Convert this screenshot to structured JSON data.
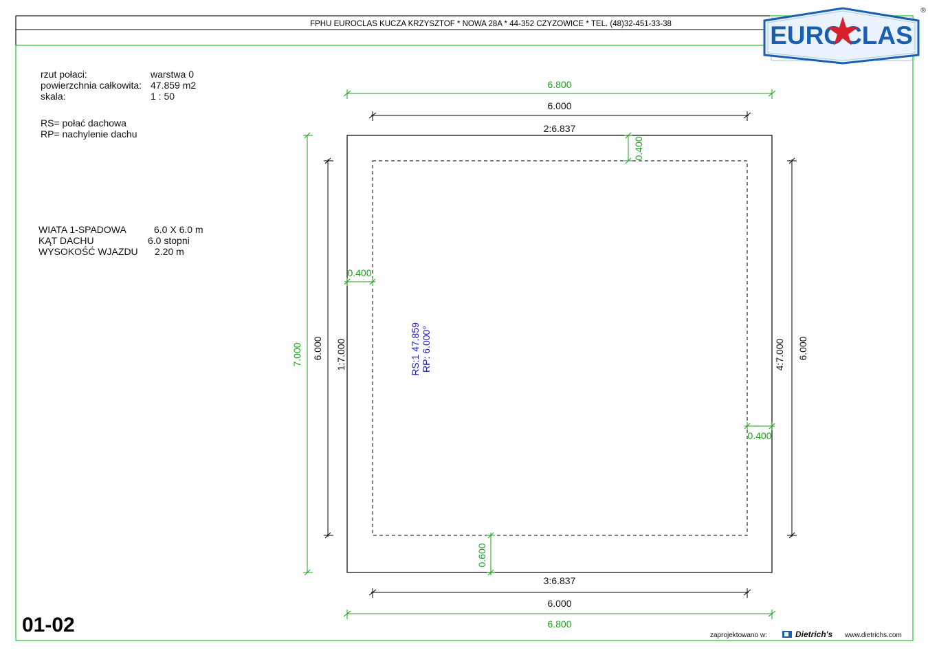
{
  "header": {
    "company_line": "FPHU EUROCLAS KUCZA KRZYSZTOF * NOWA 28A * 44-352 CZYZOWICE * TEL. (48)32-451-33-38",
    "logo_text": "EUROCLAS",
    "registered_mark": "®"
  },
  "info": {
    "rows": [
      {
        "label": "rzut połaci:",
        "value": "warstwa 0"
      },
      {
        "label": "powierzchnia całkowita:",
        "value": "47.859 m2"
      },
      {
        "label": "skala:",
        "value": "1 : 50"
      }
    ],
    "legend": [
      "RS= połać dachowa",
      "RP= nachylenie dachu"
    ]
  },
  "spec": {
    "rows": [
      {
        "label": "WIATA  1-SPADOWA",
        "value": "6.0 X 6.0 m"
      },
      {
        "label": "KĄT DACHU",
        "value": "6.0 stopni"
      },
      {
        "label": "WYSOKOŚĆ WJAZDU",
        "value": "2.20 m"
      }
    ]
  },
  "drawing": {
    "top_outer": "6.800",
    "top_inner": "6.000",
    "edge_top": "2:6.837",
    "overhang_top": "0.400",
    "overhang_left": "0.400",
    "overhang_right": "0.400",
    "overhang_bottom": "0.600",
    "left_outer": "7.000",
    "left_inner": "6.000",
    "edge_left": "1:7.000",
    "edge_right": "4:7.000",
    "right_inner": "6.000",
    "edge_bottom": "3:6.837",
    "bottom_inner": "6.000",
    "bottom_outer": "6.800",
    "roof_label_rs": "RS:1  47.859",
    "roof_label_rp": "RP:  6.000°"
  },
  "colors": {
    "frame_green": "#22c322",
    "dim_green": "#18a218",
    "label_blue": "#1a1ab0",
    "logo_blue": "#1a5fb0",
    "logo_red": "#d8202a"
  },
  "footer": {
    "sheet_number": "01-02",
    "designed_with": "zaprojektowano w:",
    "software": "Dietrich's",
    "website": "www.dietrichs.com"
  }
}
